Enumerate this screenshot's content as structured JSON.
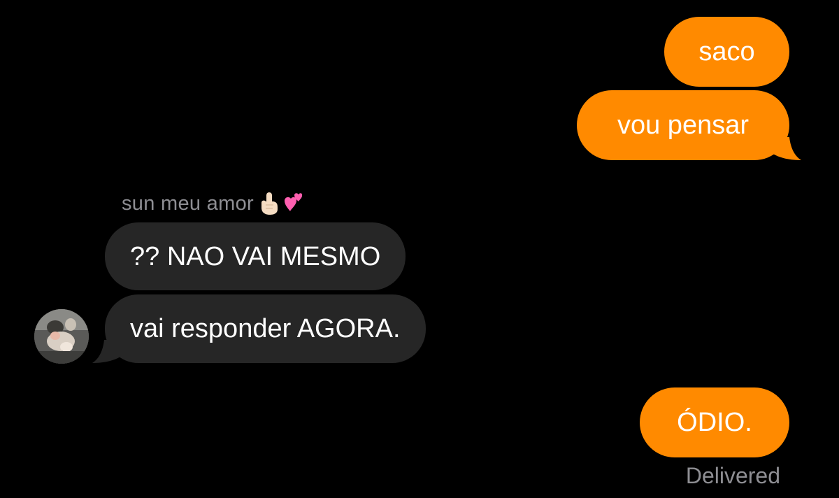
{
  "conversation": {
    "sender_name": "sun meu amor",
    "sender_emojis": [
      "finger-pointing-up-light-skin",
      "two-hearts"
    ],
    "messages": [
      {
        "id": "m1",
        "direction": "outgoing",
        "text": "saco"
      },
      {
        "id": "m2",
        "direction": "outgoing",
        "text": "vou pensar"
      },
      {
        "id": "m3",
        "direction": "incoming",
        "text": "?? NAO VAI MESMO"
      },
      {
        "id": "m4",
        "direction": "incoming",
        "text": "vai responder AGORA."
      },
      {
        "id": "m5",
        "direction": "outgoing",
        "text": "ÓDIO."
      }
    ],
    "status": "Delivered"
  },
  "colors": {
    "background": "#000000",
    "outgoing_bubble": "#ff8a00",
    "incoming_bubble": "#262626",
    "meta_text": "#8e8e93"
  }
}
